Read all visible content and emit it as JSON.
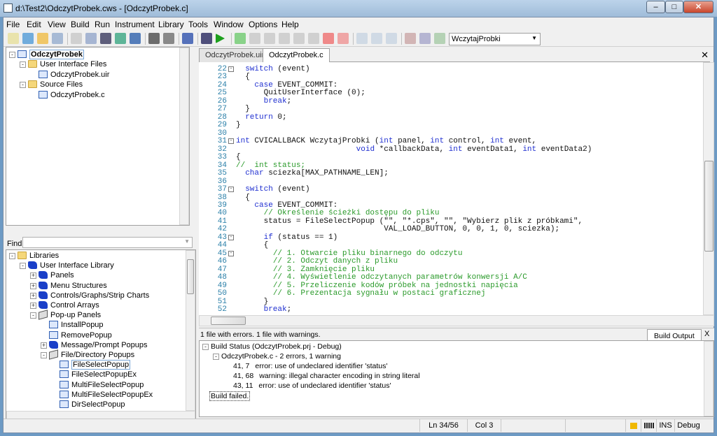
{
  "window": {
    "title": "d:\\Test2\\OdczytProbek.cws - [OdczytProbek.c]"
  },
  "menu": [
    "File",
    "Edit",
    "View",
    "Build",
    "Run",
    "Instrument",
    "Library",
    "Tools",
    "Window",
    "Options",
    "Help"
  ],
  "toolbar": {
    "function_select": "WczytajProbki"
  },
  "project_tree": [
    {
      "label": "OdczytProbek",
      "level": 0,
      "icon": "project-icon",
      "exp": "-",
      "selected": true
    },
    {
      "label": "User Interface Files",
      "level": 1,
      "icon": "folder-icon",
      "exp": "-"
    },
    {
      "label": "OdczytProbek.uir",
      "level": 2,
      "icon": "uir-file-icon"
    },
    {
      "label": "Source Files",
      "level": 1,
      "icon": "folder-icon",
      "exp": "-"
    },
    {
      "label": "OdczytProbek.c",
      "level": 2,
      "icon": "c-file-icon"
    }
  ],
  "find": {
    "label": "Find",
    "value": ""
  },
  "library_tree": [
    {
      "label": "Libraries",
      "level": 0,
      "icon": "folder-icon",
      "exp": "-"
    },
    {
      "label": "User Interface Library",
      "level": 1,
      "icon": "library-icon",
      "exp": "-"
    },
    {
      "label": "Panels",
      "level": 2,
      "icon": "book-icon",
      "exp": "+"
    },
    {
      "label": "Menu Structures",
      "level": 2,
      "icon": "book-icon",
      "exp": "+"
    },
    {
      "label": "Controls/Graphs/Strip Charts",
      "level": 2,
      "icon": "book-icon",
      "exp": "+"
    },
    {
      "label": "Control Arrays",
      "level": 2,
      "icon": "book-icon",
      "exp": "+"
    },
    {
      "label": "Pop-up Panels",
      "level": 2,
      "icon": "open-book-icon",
      "exp": "-"
    },
    {
      "label": "InstallPopup",
      "level": 3,
      "icon": "function-icon"
    },
    {
      "label": "RemovePopup",
      "level": 3,
      "icon": "function-icon"
    },
    {
      "label": "Message/Prompt Popups",
      "level": 3,
      "icon": "book-icon",
      "exp": "+"
    },
    {
      "label": "File/Directory Popups",
      "level": 3,
      "icon": "open-book-icon",
      "exp": "-"
    },
    {
      "label": "FileSelectPopup",
      "level": 4,
      "icon": "function-icon",
      "selected": true
    },
    {
      "label": "FileSelectPopupEx",
      "level": 4,
      "icon": "function-icon"
    },
    {
      "label": "MultiFileSelectPopup",
      "level": 4,
      "icon": "function-icon"
    },
    {
      "label": "MultiFileSelectPopupEx",
      "level": 4,
      "icon": "function-icon"
    },
    {
      "label": "DirSelectPopup",
      "level": 4,
      "icon": "function-icon"
    }
  ],
  "editor": {
    "tabs": [
      {
        "label": "OdczytProbek.uir",
        "active": false
      },
      {
        "label": "OdczytProbek.c",
        "active": true
      }
    ],
    "lines": [
      {
        "n": "22",
        "fold": true,
        "segs": [
          [
            "t",
            "  "
          ],
          [
            "k",
            "switch"
          ],
          [
            "t",
            " (event)"
          ]
        ]
      },
      {
        "n": "23",
        "segs": [
          [
            "t",
            "  {"
          ]
        ]
      },
      {
        "n": "24",
        "segs": [
          [
            "t",
            "    "
          ],
          [
            "k",
            "case"
          ],
          [
            "t",
            " EVENT_COMMIT:"
          ]
        ]
      },
      {
        "n": "25",
        "segs": [
          [
            "t",
            "      QuitUserInterface (0);"
          ]
        ]
      },
      {
        "n": "26",
        "segs": [
          [
            "t",
            "      "
          ],
          [
            "k",
            "break"
          ],
          [
            "t",
            ";"
          ]
        ]
      },
      {
        "n": "27",
        "segs": [
          [
            "t",
            "  }"
          ]
        ]
      },
      {
        "n": "28",
        "segs": [
          [
            "t",
            "  "
          ],
          [
            "k",
            "return"
          ],
          [
            "t",
            " 0;"
          ]
        ]
      },
      {
        "n": "29",
        "segs": [
          [
            "t",
            "}"
          ]
        ]
      },
      {
        "n": "30",
        "segs": []
      },
      {
        "n": "31",
        "fold": true,
        "segs": [
          [
            "k",
            "int"
          ],
          [
            "t",
            " CVICALLBACK WczytajProbki ("
          ],
          [
            "k",
            "int"
          ],
          [
            "t",
            " panel, "
          ],
          [
            "k",
            "int"
          ],
          [
            "t",
            " control, "
          ],
          [
            "k",
            "int"
          ],
          [
            "t",
            " event,"
          ]
        ]
      },
      {
        "n": "32",
        "segs": [
          [
            "t",
            "                          "
          ],
          [
            "k",
            "void"
          ],
          [
            "t",
            " *callbackData, "
          ],
          [
            "k",
            "int"
          ],
          [
            "t",
            " eventData1, "
          ],
          [
            "k",
            "int"
          ],
          [
            "t",
            " eventData2)"
          ]
        ]
      },
      {
        "n": "33",
        "segs": [
          [
            "t",
            "{"
          ]
        ]
      },
      {
        "n": "34",
        "segs": [
          [
            "c",
            "//  int status;"
          ]
        ]
      },
      {
        "n": "35",
        "segs": [
          [
            "t",
            "  "
          ],
          [
            "k",
            "char"
          ],
          [
            "t",
            " sciezka[MAX_PATHNAME_LEN];"
          ]
        ]
      },
      {
        "n": "36",
        "segs": []
      },
      {
        "n": "37",
        "fold": true,
        "segs": [
          [
            "t",
            "  "
          ],
          [
            "k",
            "switch"
          ],
          [
            "t",
            " (event)"
          ]
        ]
      },
      {
        "n": "38",
        "segs": [
          [
            "t",
            "  {"
          ]
        ]
      },
      {
        "n": "39",
        "segs": [
          [
            "t",
            "    "
          ],
          [
            "k",
            "case"
          ],
          [
            "t",
            " EVENT_COMMIT:"
          ]
        ]
      },
      {
        "n": "40",
        "segs": [
          [
            "t",
            "      "
          ],
          [
            "c",
            "// Określenie ścieżki dostępu do pliku"
          ]
        ]
      },
      {
        "n": "41",
        "segs": [
          [
            "t",
            "      status = FileSelectPopup (\"\", \"*.cps\", \"\", \"Wybierz plik z próbkami\","
          ]
        ]
      },
      {
        "n": "42",
        "segs": [
          [
            "t",
            "                                VAL_LOAD_BUTTON, 0, 0, 1, 0, sciezka);"
          ]
        ]
      },
      {
        "n": "43",
        "fold": true,
        "segs": [
          [
            "t",
            "      "
          ],
          [
            "k",
            "if"
          ],
          [
            "t",
            " (status == 1)"
          ]
        ]
      },
      {
        "n": "44",
        "segs": [
          [
            "t",
            "      {"
          ]
        ]
      },
      {
        "n": "45",
        "fold": true,
        "segs": [
          [
            "t",
            "        "
          ],
          [
            "c",
            "// 1. Otwarcie pliku binarnego do odczytu"
          ]
        ]
      },
      {
        "n": "46",
        "segs": [
          [
            "t",
            "        "
          ],
          [
            "c",
            "// 2. Odczyt danych z pliku"
          ]
        ]
      },
      {
        "n": "47",
        "segs": [
          [
            "t",
            "        "
          ],
          [
            "c",
            "// 3. Zamknięcie pliku"
          ]
        ]
      },
      {
        "n": "48",
        "segs": [
          [
            "t",
            "        "
          ],
          [
            "c",
            "// 4. Wyświetlenie odczytanych parametrów konwersji A/C"
          ]
        ]
      },
      {
        "n": "49",
        "segs": [
          [
            "t",
            "        "
          ],
          [
            "c",
            "// 5. Przeliczenie kodów próbek na jednostki napięcia"
          ]
        ]
      },
      {
        "n": "50",
        "segs": [
          [
            "t",
            "        "
          ],
          [
            "c",
            "// 6. Prezentacja sygnału w postaci graficznej"
          ]
        ]
      },
      {
        "n": "51",
        "segs": [
          [
            "t",
            "      }"
          ]
        ]
      },
      {
        "n": "52",
        "segs": [
          [
            "t",
            "      "
          ],
          [
            "k",
            "break"
          ],
          [
            "t",
            ";"
          ]
        ]
      }
    ]
  },
  "build": {
    "summary": "1 file with errors.  1 file with warnings.",
    "tab": "Build Output",
    "close": "X",
    "status": "Build Status (OdczytProbek.prj - Debug)",
    "file": "OdczytProbek.c - 2 errors, 1 warning",
    "messages": [
      {
        "loc": "41, 7",
        "text": "error: use of undeclared identifier 'status'"
      },
      {
        "loc": "41, 68",
        "text": "warning: illegal character encoding in string literal"
      },
      {
        "loc": "43, 11",
        "text": "error: use of undeclared identifier 'status'"
      }
    ],
    "result": "Build failed."
  },
  "statusbar": {
    "line": "Ln 34/56",
    "col": "Col 3",
    "mode": "INS",
    "config": "Debug"
  },
  "colors": {
    "keyword": "#1f2fd0",
    "comment": "#2a9a2a",
    "line_number": "#2a7fa8"
  }
}
